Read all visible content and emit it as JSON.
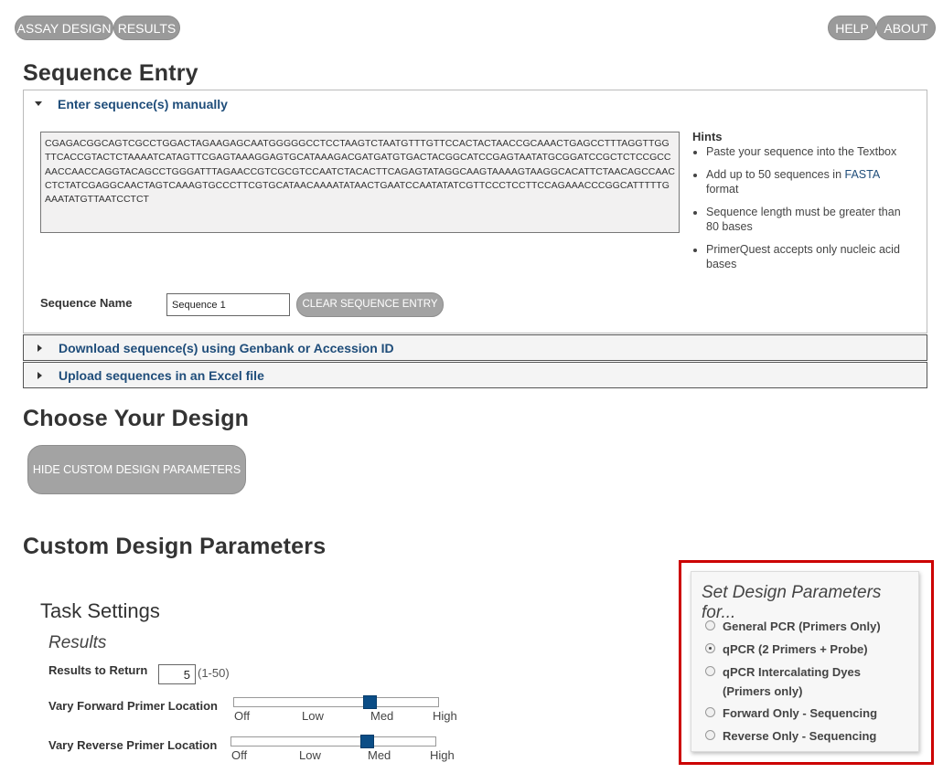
{
  "nav": {
    "left": [
      "ASSAY DESIGN",
      "RESULTS"
    ],
    "right": [
      "HELP",
      "ABOUT"
    ]
  },
  "sequence_entry": {
    "heading": "Sequence Entry",
    "manual_label": "Enter sequence(s) manually",
    "sequence_text": "CGAGACGGCAGTCGCCTGGACTAGAAGAGCAATGGGGGCCTCCTAAGTCTAATGTTTGTTCCACTACTAACCGCAAACTGAGCCTTTAGGTTGGTTCACCGTACTCTAAAATCATAGTTCGAGTAAAGGAGTGCATAAAGACGATGATGTGACTACGGCATCCGAGTAATATGCGGATCCGCTCTCCGCCAACCAACCAGGTACAGCCTGGGATTTAGAACCGTCGCGTCCAATCTACACTTCAGAGTATAGGCAAGTAAAAGTAAGGCACATTCTAACAGCCAACCTCTATCGAGGCAACTAGTCAAAGTGCCCTTCGTGCATAACAAAATATAACTGAATCCAATATATCGTTCCCTCCTTCCAGAAACCCGGCATTTTTGAAATATGTTAATCCTCT",
    "hints_title": "Hints",
    "hints": [
      {
        "text": "Paste your sequence into the Textbox"
      },
      {
        "pre": "Add up to 50 sequences in ",
        "link": "FASTA",
        "post": " format"
      },
      {
        "text": "Sequence length must be greater than 80 bases"
      },
      {
        "text": "PrimerQuest accepts only nucleic acid bases"
      }
    ],
    "name_label": "Sequence Name",
    "name_value": "Sequence 1",
    "clear_label": "CLEAR SEQUENCE ENTRY",
    "genbank_label": "Download sequence(s) using Genbank or Accession ID",
    "excel_label": "Upload sequences in an Excel file"
  },
  "design": {
    "heading": "Choose Your Design",
    "hide_button": "HIDE CUSTOM DESIGN PARAMETERS"
  },
  "custom": {
    "heading": "Custom Design Parameters",
    "task_settings": "Task Settings",
    "results_sub": "Results",
    "results_to_return_label": "Results to Return",
    "results_to_return_value": "5",
    "results_range": "(1-50)",
    "vary_forward_label": "Vary Forward Primer Location",
    "vary_reverse_label": "Vary Reverse Primer Location",
    "slider_ticks": [
      "Off",
      "Low",
      "Med",
      "High"
    ],
    "forward_level": "Med",
    "reverse_level": "Med"
  },
  "params_for": {
    "title": "Set Design Parameters for...",
    "options": [
      {
        "label": "General PCR (Primers Only)",
        "selected": false
      },
      {
        "label": "qPCR (2 Primers + Probe)",
        "selected": true
      },
      {
        "label": "qPCR Intercalating Dyes (Primers only)",
        "selected": false
      },
      {
        "label": "Forward Only - Sequencing",
        "selected": false
      },
      {
        "label": "Reverse Only - Sequencing",
        "selected": false
      }
    ]
  }
}
